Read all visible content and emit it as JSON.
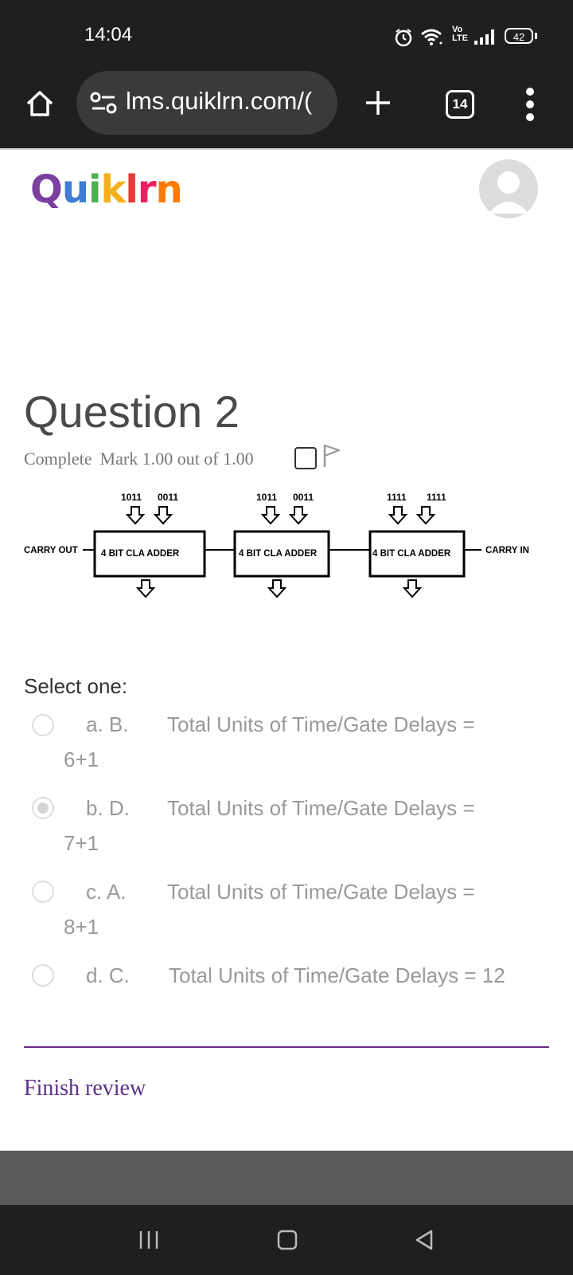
{
  "status_bar": {
    "time": "14:04",
    "network_label": "Vo LTE",
    "battery": "42"
  },
  "browser": {
    "url": "lms.quiklrn.com/(",
    "tab_count": "14"
  },
  "site": {
    "logo_text": "Quiklrn"
  },
  "question": {
    "title": "Question 2",
    "state": "Complete",
    "mark": "Mark 1.00 out of 1.00"
  },
  "diagram": {
    "blocks": [
      {
        "inputs": [
          "1011",
          "0011"
        ],
        "label": "4 BIT CLA ADDER"
      },
      {
        "inputs": [
          "1011",
          "0011"
        ],
        "label": "4 BIT CLA ADDER"
      },
      {
        "inputs": [
          "1111",
          "1111"
        ],
        "label": "4 BIT CLA ADDER"
      }
    ],
    "carry_out_label": "CARRY OUT",
    "carry_in_label": "CARRY IN"
  },
  "answers": {
    "prompt": "Select one:",
    "options": [
      {
        "letter": "a. B.",
        "text": "Total Units of Time/Gate Delays =",
        "continuation": "6+1",
        "selected": false
      },
      {
        "letter": "b. D.",
        "text": "Total Units of Time/Gate Delays =",
        "continuation": "7+1",
        "selected": true
      },
      {
        "letter": "c. A.",
        "text": "Total Units of Time/Gate Delays =",
        "continuation": "8+1",
        "selected": false
      },
      {
        "letter": "d. C.",
        "text": "Total Units of Time/Gate Delays = 12",
        "continuation": "",
        "selected": false
      }
    ]
  },
  "footer": {
    "finish_label": "Finish review"
  },
  "colors": {
    "logo_q": "#7b3fa0",
    "logo_u": "#3e7bd6",
    "logo_i": "#4caf50",
    "logo_k": "#f2b01e",
    "logo_l": "#e53935",
    "logo_r": "#e91e63",
    "logo_n": "#ff7a00",
    "accent": "#5e2f8c"
  }
}
